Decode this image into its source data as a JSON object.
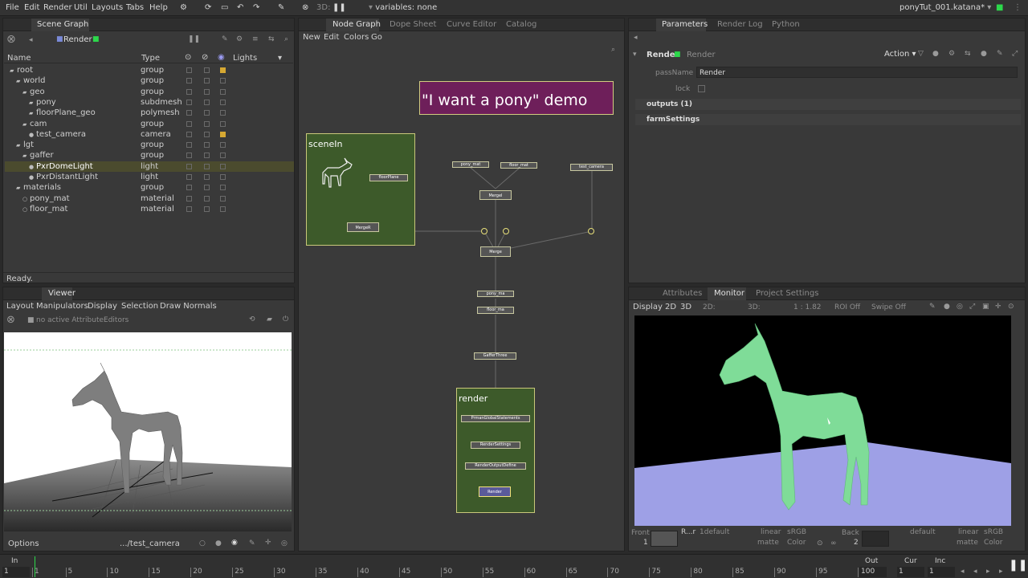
{
  "menu": [
    "File",
    "Edit",
    "Render",
    "Util",
    "Layouts",
    "Tabs",
    "Help"
  ],
  "toolbar": {
    "mode_3d": "3D:",
    "variables": "variables: none",
    "project": "ponyTut_001.katana*"
  },
  "scene_graph": {
    "tab": "Scene Graph",
    "node_label": "Render",
    "columns": {
      "name": "Name",
      "type": "Type",
      "lights": "Lights"
    },
    "rows": [
      {
        "name": "root",
        "type": "group"
      },
      {
        "name": "world",
        "type": "group"
      },
      {
        "name": "geo",
        "type": "group"
      },
      {
        "name": "pony",
        "type": "subdmesh"
      },
      {
        "name": "floorPlane_geo",
        "type": "polymesh"
      },
      {
        "name": "cam",
        "type": "group"
      },
      {
        "name": "test_camera",
        "type": "camera"
      },
      {
        "name": "lgt",
        "type": "group"
      },
      {
        "name": "gaffer",
        "type": "group"
      },
      {
        "name": "PxrDomeLight",
        "type": "light"
      },
      {
        "name": "PxrDistantLight",
        "type": "light"
      },
      {
        "name": "materials",
        "type": "group"
      },
      {
        "name": "pony_mat",
        "type": "material"
      },
      {
        "name": "floor_mat",
        "type": "material"
      }
    ],
    "status": "Ready."
  },
  "viewer": {
    "tab": "Viewer",
    "menu": [
      "Layout",
      "Manipulators",
      "Display",
      "Selection",
      "Draw Normals"
    ],
    "no_editors": "no active AttributeEditors",
    "options": "Options",
    "camera": ".../test_camera"
  },
  "node_graph": {
    "tabs": [
      "Node Graph",
      "Dope Sheet",
      "Curve Editor",
      "Catalog"
    ],
    "menu": [
      "New",
      "Edit",
      "Colors",
      "Go"
    ],
    "backdrop": "\"I want a pony\" demo",
    "group_scenein": "sceneIn",
    "group_render": "render",
    "nodes": {
      "floorPlane": "floorPlane",
      "merge_in": "MergeR",
      "pony_mat": "pony_mat",
      "floor_mat": "floor_mat",
      "test_camera": "test_camera",
      "merge1": "MergeI",
      "merge2": "Merge",
      "pony_ma": "pony_ma",
      "floor_ma": "floor_ma",
      "gaffer": "GafferThree",
      "prman": "PrmanGlobalStatements",
      "render_settings": "RenderSettings",
      "output_define": "RenderOutputDefine",
      "render": "Render"
    }
  },
  "parameters": {
    "tabs": [
      "Parameters",
      "Render Log",
      "Python"
    ],
    "node": "Render",
    "node_type": "Render",
    "action": "Action",
    "passname_label": "passName",
    "passname_value": "Render",
    "lock": "lock",
    "outputs": "outputs (1)",
    "farm": "farmSettings"
  },
  "monitor": {
    "tabs": [
      "Attributes",
      "Monitor",
      "Project Settings"
    ],
    "menu": [
      "Display",
      "2D",
      "3D"
    ],
    "twod": "2D:",
    "threed": "3D:",
    "ratio": "1 : 1.82",
    "roi": "ROI Off",
    "swipe": "Swipe Off",
    "front": "Front",
    "front_num": "1",
    "r_label": "R...r",
    "default1": "1default",
    "colorspace1": "linear",
    "srgb1": "sRGB",
    "matte1": "matte",
    "color1": "Color",
    "back": "Back",
    "back_num": "2",
    "default2": "default",
    "colorspace2": "linear",
    "srgb2": "sRGB",
    "matte2": "matte",
    "color2": "Color"
  },
  "timeline": {
    "in_label": "In",
    "in_value": "1",
    "ticks": [
      "1",
      "5",
      "10",
      "15",
      "20",
      "25",
      "30",
      "35",
      "40",
      "45",
      "50",
      "55",
      "60",
      "65",
      "70",
      "75",
      "80",
      "85",
      "90",
      "95",
      "100"
    ],
    "out_label": "Out",
    "out_value": "100",
    "cur_label": "Cur",
    "cur_value": "1",
    "inc_label": "Inc",
    "inc_value": "1"
  },
  "colors": {
    "node_group": "#3d5a2a",
    "backdrop": "#6e1f5a",
    "accent": "#f3e37a",
    "floor": "#9ea0e6",
    "horse": "#7fdc98"
  }
}
